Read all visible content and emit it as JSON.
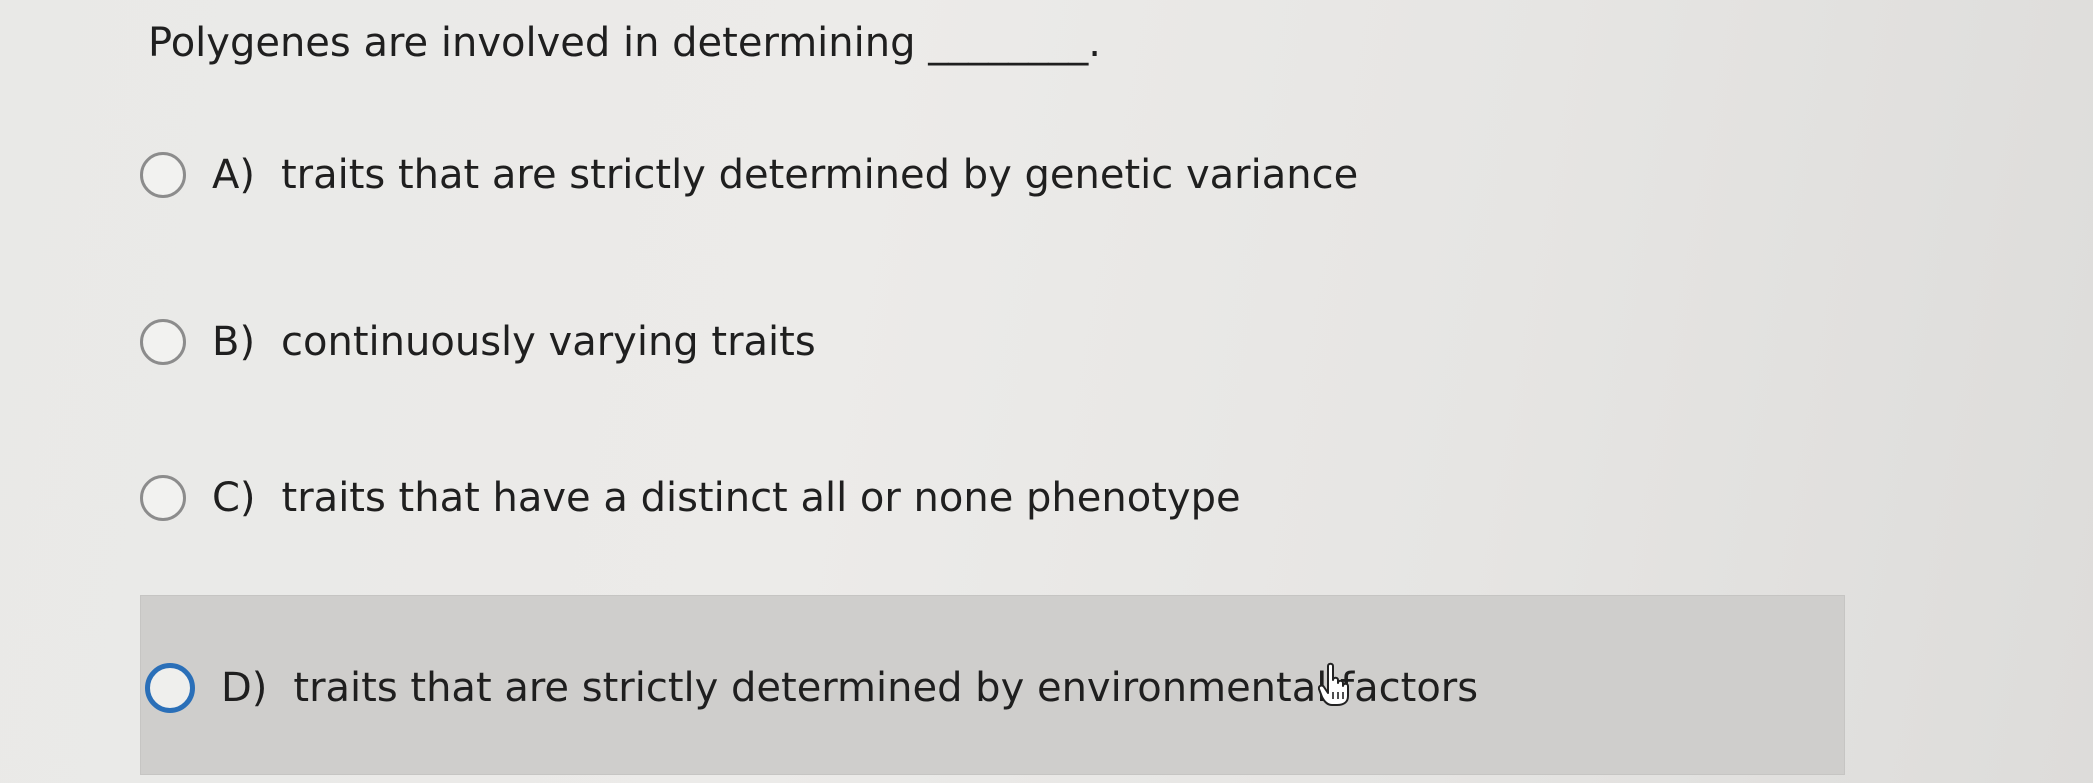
{
  "question": {
    "text": "Polygenes are involved in determining ________."
  },
  "options": [
    {
      "letter": "A)",
      "text": "traits that are strictly determined by genetic variance",
      "selected": false
    },
    {
      "letter": "B)",
      "text": "continuously varying traits",
      "selected": false
    },
    {
      "letter": "C)",
      "text": "traits that have a distinct all or none phenotype",
      "selected": false
    },
    {
      "letter": "D)",
      "text": "traits that are strictly determined by environmental factors",
      "selected": false
    }
  ],
  "colors": {
    "highlight": "#cfcecc",
    "focused_radio": "#2a6fb8"
  },
  "icons": {
    "cursor": "hand-pointer-icon"
  }
}
